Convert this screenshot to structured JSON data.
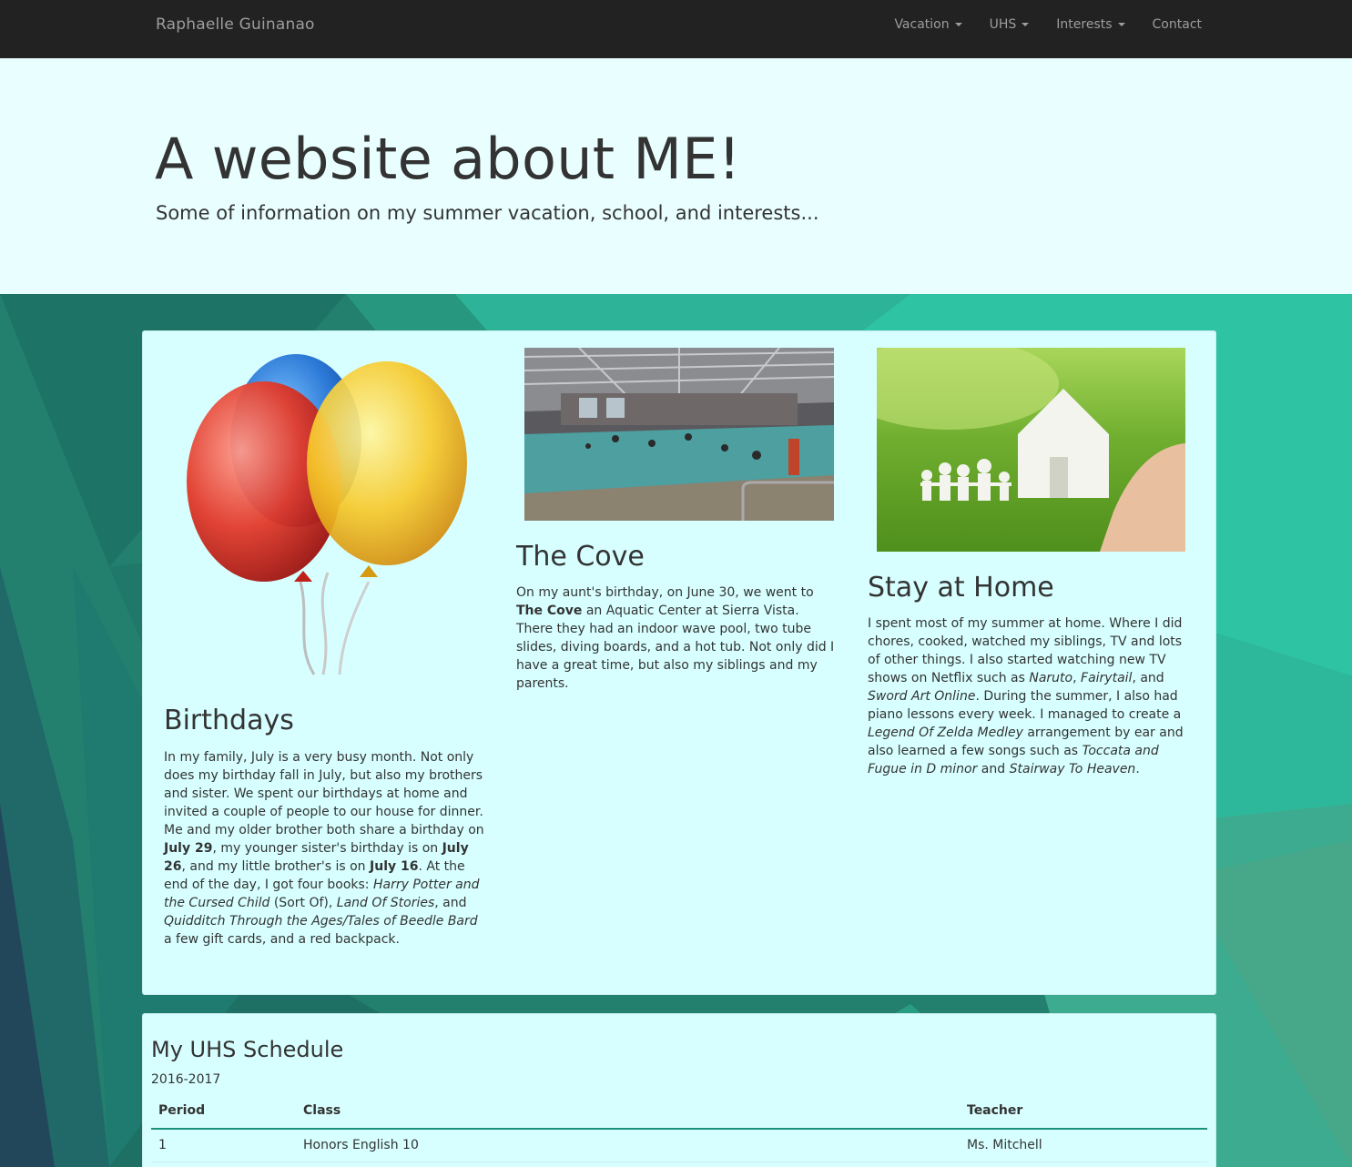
{
  "navbar": {
    "brand": "Raphaelle Guinanao",
    "items": [
      {
        "label": "Vacation",
        "dropdown": true
      },
      {
        "label": "UHS",
        "dropdown": true
      },
      {
        "label": "Interests",
        "dropdown": true
      },
      {
        "label": "Contact",
        "dropdown": false
      }
    ]
  },
  "jumbotron": {
    "title": "A website about ME!",
    "subtitle": "Some of information on my summer vacation, school, and interests..."
  },
  "vacation": {
    "birthdays": {
      "heading": "Birthdays",
      "text": [
        {
          "t": "In my family, July is a very busy month. Not only does my birthday fall in July, but also my brothers and sister. We spent our birthdays at home and invited a couple of people to our house for dinner. Me and my older brother both share a birthday on "
        },
        {
          "t": "July 29",
          "style": "b"
        },
        {
          "t": ", my younger sister's birthday is on "
        },
        {
          "t": "July 26",
          "style": "b"
        },
        {
          "t": ", and my little brother's is on "
        },
        {
          "t": "July 16",
          "style": "b"
        },
        {
          "t": ". At the end of the day, I got four books: "
        },
        {
          "t": "Harry Potter and the Cursed Child",
          "style": "i"
        },
        {
          "t": " (Sort Of), "
        },
        {
          "t": "Land Of Stories",
          "style": "i"
        },
        {
          "t": ", and "
        },
        {
          "t": "Quidditch Through the Ages/Tales of Beedle Bard",
          "style": "i"
        },
        {
          "t": " a few gift cards, and a red backpack."
        }
      ]
    },
    "cove": {
      "heading": "The Cove",
      "text": [
        {
          "t": "On my aunt's birthday, on June 30, we went to "
        },
        {
          "t": "The Cove",
          "style": "b"
        },
        {
          "t": " an Aquatic Center at Sierra Vista. There they had an indoor wave pool, two tube slides, diving boards, and a hot tub. Not only did I have a great time, but also my siblings and my parents."
        }
      ]
    },
    "home": {
      "heading": "Stay at Home",
      "text": [
        {
          "t": "I spent most of my summer at home. Where I did chores, cooked, watched my siblings, TV and lots of other things. I also started watching new TV shows on Netflix such as "
        },
        {
          "t": "Naruto",
          "style": "i"
        },
        {
          "t": ", "
        },
        {
          "t": "Fairytail",
          "style": "i"
        },
        {
          "t": ", and "
        },
        {
          "t": "Sword Art Online",
          "style": "i"
        },
        {
          "t": ". During the summer, I also had piano lessons every week. I managed to create a "
        },
        {
          "t": "Legend Of Zelda Medley",
          "style": "i"
        },
        {
          "t": " arrangement by ear and also learned a few songs such as "
        },
        {
          "t": "Toccata and Fugue in D minor",
          "style": "i"
        },
        {
          "t": " and "
        },
        {
          "t": "Stairway To Heaven",
          "style": "i"
        },
        {
          "t": "."
        }
      ]
    }
  },
  "schedule": {
    "title": "My UHS Schedule",
    "year": "2016-2017",
    "headers": [
      "Period",
      "Class",
      "Teacher"
    ],
    "rows": [
      [
        "1",
        "Honors English 10",
        "Ms. Mitchell"
      ]
    ]
  }
}
